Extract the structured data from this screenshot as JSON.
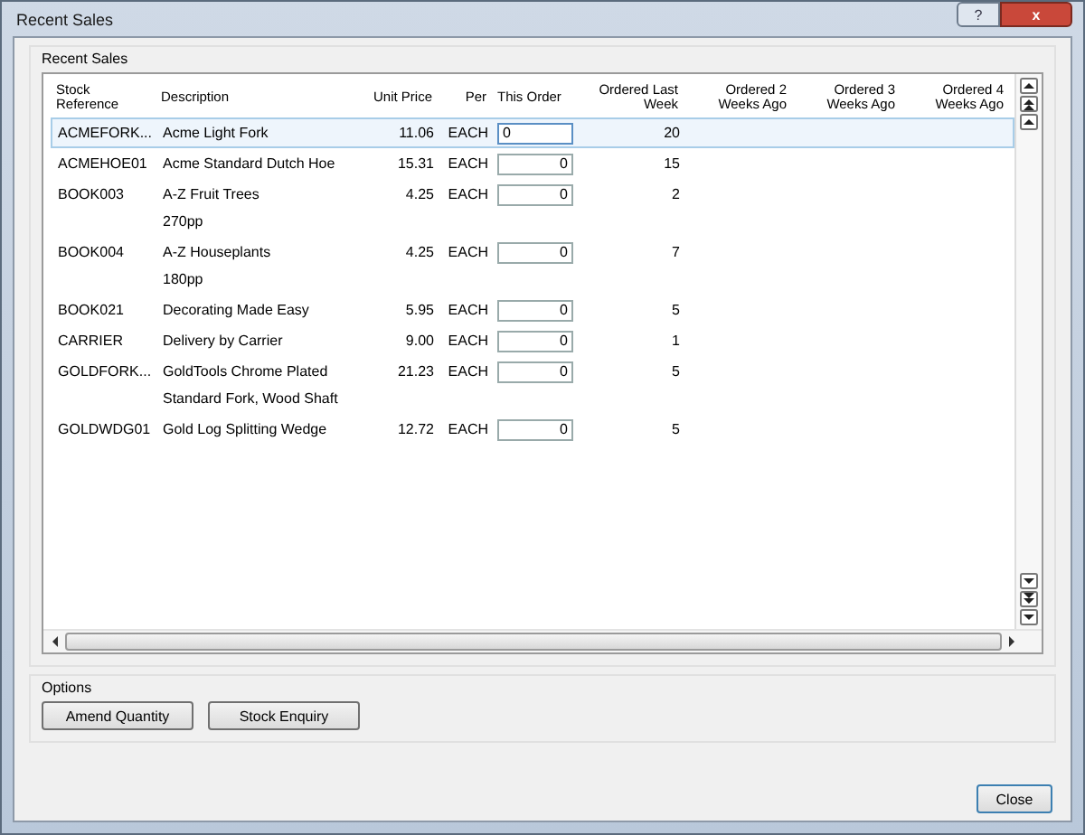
{
  "window": {
    "title": "Recent Sales",
    "help": "?",
    "close": "x"
  },
  "recent_sales": {
    "title": "Recent Sales",
    "columns": [
      "Stock Reference",
      "Description",
      "Unit Price",
      "Per",
      "This Order",
      "Ordered Last Week",
      "Ordered 2 Weeks Ago",
      "Ordered 3 Weeks Ago",
      "Ordered 4 Weeks Ago"
    ],
    "rows": [
      {
        "stock_reference": "ACMEFORK...",
        "description": "Acme Light Fork",
        "unit_price": "11.06",
        "per": "EACH",
        "this_order": "0",
        "last_week": "20",
        "selected": true
      },
      {
        "stock_reference": "ACMEHOE01",
        "description": "Acme Standard Dutch Hoe",
        "unit_price": "15.31",
        "per": "EACH",
        "this_order": "0",
        "last_week": "15",
        "selected": false
      },
      {
        "stock_reference": "BOOK003",
        "description": "A-Z Fruit Trees",
        "note": "270pp",
        "unit_price": "4.25",
        "per": "EACH",
        "this_order": "0",
        "last_week": "2",
        "selected": false
      },
      {
        "stock_reference": "BOOK004",
        "description": "A-Z Houseplants",
        "note": "180pp",
        "unit_price": "4.25",
        "per": "EACH",
        "this_order": "0",
        "last_week": "7",
        "selected": false
      },
      {
        "stock_reference": "BOOK021",
        "description": "Decorating Made Easy",
        "unit_price": "5.95",
        "per": "EACH",
        "this_order": "0",
        "last_week": "5",
        "selected": false
      },
      {
        "stock_reference": "CARRIER",
        "description": "Delivery by Carrier",
        "unit_price": "9.00",
        "per": "EACH",
        "this_order": "0",
        "last_week": "1",
        "selected": false
      },
      {
        "stock_reference": "GOLDFORK...",
        "description": "GoldTools Chrome Plated",
        "note": "Standard Fork, Wood Shaft",
        "unit_price": "21.23",
        "per": "EACH",
        "this_order": "0",
        "last_week": "5",
        "selected": false
      },
      {
        "stock_reference": "GOLDWDG01",
        "description": "Gold Log Splitting Wedge",
        "unit_price": "12.72",
        "per": "EACH",
        "this_order": "0",
        "last_week": "5",
        "selected": false
      }
    ]
  },
  "options": {
    "title": "Options",
    "buttons": [
      "Amend Quantity",
      "Stock Enquiry"
    ]
  },
  "close_button": "Close"
}
